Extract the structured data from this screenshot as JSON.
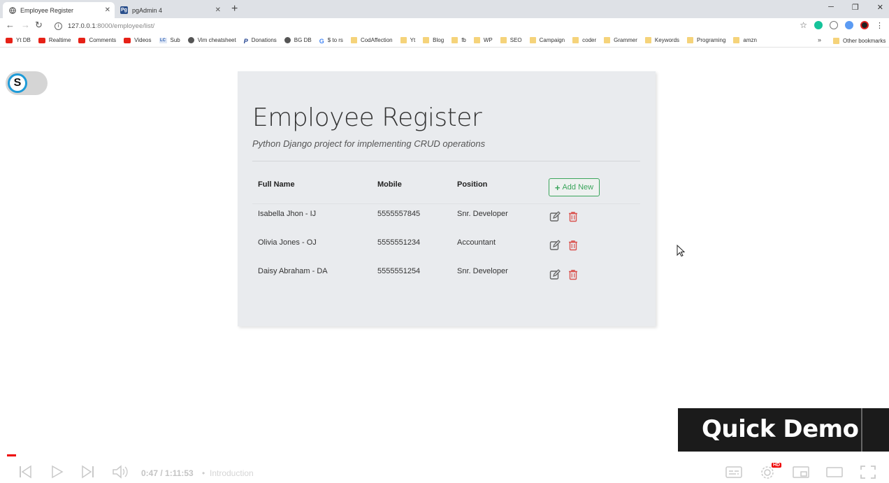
{
  "browser": {
    "tabs": [
      {
        "title": "Employee Register",
        "active": true
      },
      {
        "title": "pgAdmin 4",
        "icon_text": "Pg",
        "active": false
      }
    ],
    "url_host": "127.0.0.1",
    "url_path": ":8000/employee/list/",
    "bookmarks": [
      {
        "label": "Yt DB",
        "icon": "youtube-icon"
      },
      {
        "label": "Realtime",
        "icon": "youtube-icon"
      },
      {
        "label": "Comments",
        "icon": "youtube-icon"
      },
      {
        "label": "Videos",
        "icon": "youtube-icon"
      },
      {
        "label": "Sub",
        "icon": "lc-icon",
        "icon_text": "LC"
      },
      {
        "label": "Vim cheatsheet",
        "icon": "globe-icon"
      },
      {
        "label": "Donations",
        "icon": "paypal-icon",
        "icon_text": "P"
      },
      {
        "label": "BG DB",
        "icon": "globe-icon"
      },
      {
        "label": "$ to rs",
        "icon": "google-icon",
        "icon_text": "G"
      },
      {
        "label": "CodAffection",
        "icon": "folder-icon"
      },
      {
        "label": "Yt",
        "icon": "folder-icon"
      },
      {
        "label": "Blog",
        "icon": "folder-icon"
      },
      {
        "label": "fb",
        "icon": "folder-icon"
      },
      {
        "label": "WP",
        "icon": "folder-icon"
      },
      {
        "label": "SEO",
        "icon": "folder-icon"
      },
      {
        "label": "Campaign",
        "icon": "folder-icon"
      },
      {
        "label": "coder",
        "icon": "folder-icon"
      },
      {
        "label": "Grammer",
        "icon": "folder-icon"
      },
      {
        "label": "Keywords",
        "icon": "folder-icon"
      },
      {
        "label": "Programing",
        "icon": "folder-icon"
      },
      {
        "label": "amzn",
        "icon": "folder-icon"
      }
    ],
    "more_bookmarks": "»",
    "other_bookmarks": "Other bookmarks"
  },
  "toggle": {
    "letter": "S"
  },
  "page": {
    "title": "Employee Register",
    "subtitle": "Python Django project for implementing CRUD operations",
    "columns": [
      "Full Name",
      "Mobile",
      "Position"
    ],
    "add_button": "Add New",
    "add_icon": "+",
    "rows": [
      {
        "name": "Isabella Jhon - IJ",
        "mobile": "5555557845",
        "position": "Snr. Developer"
      },
      {
        "name": "Olivia Jones - OJ",
        "mobile": "5555551234",
        "position": "Accountant"
      },
      {
        "name": "Daisy Abraham - DA",
        "mobile": "5555551254",
        "position": "Snr. Developer"
      }
    ],
    "colors": {
      "add_green": "#3ba55c",
      "delete_red": "#d9534f",
      "edit_gray": "#666666"
    }
  },
  "video": {
    "overlay_text": "Quick Demo",
    "time": "0:47 / 1:11:53",
    "chapter_sep": "•",
    "chapter": "Introduction",
    "hd_badge": "HD",
    "progress_fraction": 0.011
  }
}
